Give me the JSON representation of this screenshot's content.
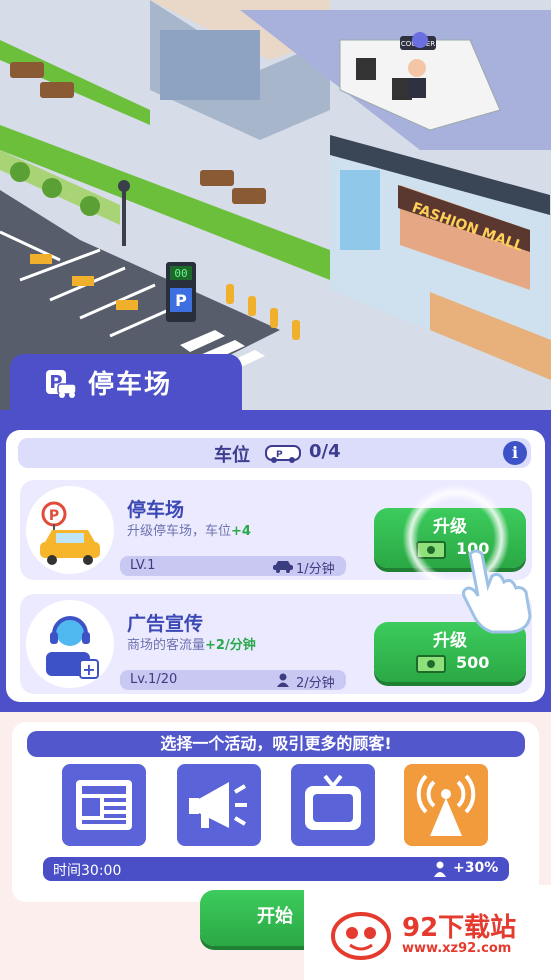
{
  "scene": {
    "store_sign": "FASHION MALL",
    "counter_sign": "COUNTER",
    "meter_display": "00"
  },
  "header": {
    "title": "停车场"
  },
  "slots": {
    "label": "车位",
    "count": "0/4"
  },
  "cards": [
    {
      "title": "停车场",
      "desc_prefix": "升级停车场，车位",
      "desc_highlight": "+4",
      "level": "LV.1",
      "rate": "1/分钟",
      "button_label": "升级",
      "cost": "100"
    },
    {
      "title": "广告宣传",
      "desc_prefix": "商场的客流量",
      "desc_highlight": "+2/分钟",
      "level": "Lv.1/20",
      "rate": "2/分钟",
      "button_label": "升级",
      "cost": "500"
    }
  ],
  "activity": {
    "header": "选择一个活动，吸引更多的顾客!",
    "options": [
      "newspaper-icon",
      "megaphone-icon",
      "tv-icon",
      "broadcast-icon"
    ],
    "time": "时间30:00",
    "bonus": "+30%",
    "start_label": "开始"
  },
  "watermark": {
    "brand": "92下载站",
    "url": "www.xz92.com"
  },
  "colors": {
    "primary": "#4d50c9",
    "green": "#2aa844",
    "orange": "#f29b3c",
    "accent_text": "#3c48b4"
  }
}
